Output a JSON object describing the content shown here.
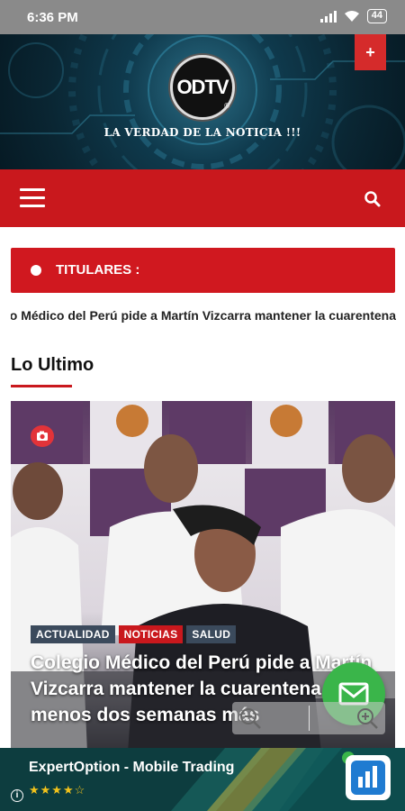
{
  "status_bar": {
    "time": "6:36 PM",
    "battery": "44"
  },
  "header": {
    "logo_text": "ODTV",
    "tagline": "LA VERDAD DE LA NOTICIA !!!",
    "plus_label": "+"
  },
  "breaking": {
    "label": "TITULARES :",
    "ticker_text": "Colegio Médico del Perú pide a Martín Vizcarra mantener la cuarentena"
  },
  "section": {
    "title": "Lo Ultimo"
  },
  "featured": {
    "tags": [
      "ACTUALIDAD",
      "NOTICIAS",
      "SALUD"
    ],
    "headline": "Colegio Médico del Perú pide a Martín Vizcarra mantener la cuarentena al menos dos semanas más"
  },
  "ad": {
    "title": "ExpertOption - Mobile Trading",
    "stars": "★★★★☆",
    "info": "i"
  },
  "colors": {
    "brand_red": "#c9181d",
    "ad_background": "#0d3d3f",
    "fab_green": "#3ab54a"
  }
}
